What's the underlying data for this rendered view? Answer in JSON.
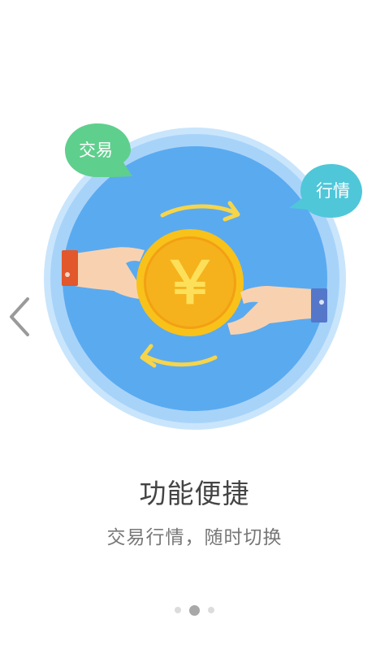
{
  "slide": {
    "title": "功能便捷",
    "subtitle": "交易行情，随时切换",
    "bubble_left": "交易",
    "bubble_right": "行情",
    "coin_symbol": "￥",
    "current_page": 2,
    "total_pages": 3
  },
  "icons": {
    "prev": "chevron-left-icon",
    "coin": "yen-coin-icon",
    "arrows": "exchange-arrows-icon",
    "hands": "hands-exchange-icon"
  },
  "colors": {
    "circle_outer": "#bfe0fb",
    "circle_inner": "#5aaaf0",
    "bubble_left": "#5fcf8d",
    "bubble_right": "#4fc7d9",
    "coin_rim": "#f7b716",
    "coin_face": "#f2a014",
    "arrow": "#f6d54a",
    "cuff_left": "#e2572b",
    "cuff_right": "#5577c9",
    "skin": "#f8d2b0"
  }
}
